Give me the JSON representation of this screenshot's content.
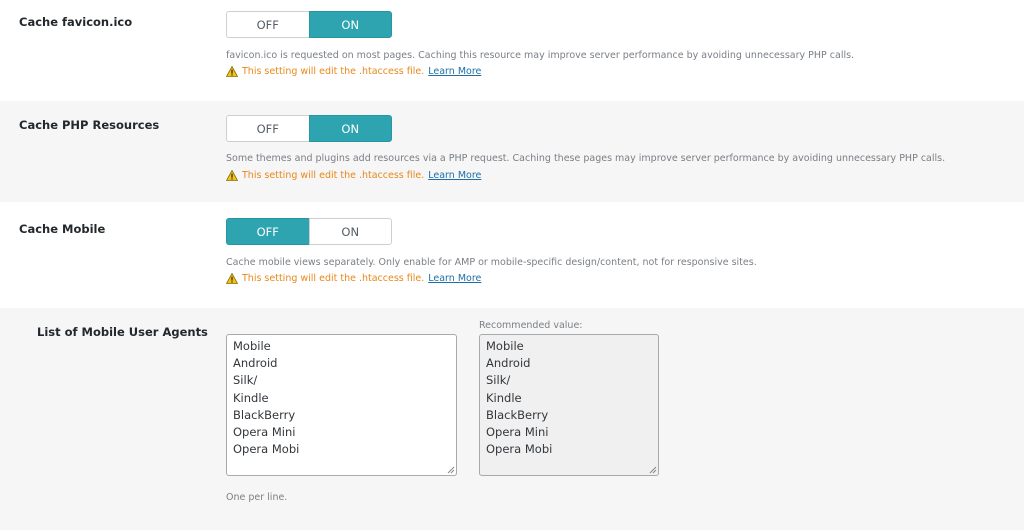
{
  "settings": [
    {
      "label": "Cache favicon.ico",
      "off_label": "OFF",
      "on_label": "ON",
      "state": "on",
      "description": "favicon.ico is requested on most pages. Caching this resource may improve server performance by avoiding unnecessary PHP calls.",
      "warning": "This setting will edit the .htaccess file.",
      "learn_more": "Learn More"
    },
    {
      "label": "Cache PHP Resources",
      "off_label": "OFF",
      "on_label": "ON",
      "state": "on",
      "description": "Some themes and plugins add resources via a PHP request. Caching these pages may improve server performance by avoiding unnecessary PHP calls.",
      "warning": "This setting will edit the .htaccess file.",
      "learn_more": "Learn More"
    },
    {
      "label": "Cache Mobile",
      "off_label": "OFF",
      "on_label": "ON",
      "state": "off",
      "description": "Cache mobile views separately. Only enable for AMP or mobile-specific design/content, not for responsive sites.",
      "warning": "This setting will edit the .htaccess file.",
      "learn_more": "Learn More"
    }
  ],
  "mobile_agents": {
    "label": "List of Mobile User Agents",
    "value": "Mobile\nAndroid\nSilk/\nKindle\nBlackBerry\nOpera Mini\nOpera Mobi",
    "recommended_label": "Recommended value:",
    "recommended_value": "Mobile\nAndroid\nSilk/\nKindle\nBlackBerry\nOpera Mini\nOpera Mobi",
    "hint": "One per line."
  },
  "colors": {
    "accent": "#2fa4b1",
    "warning": "#e9881a",
    "link": "#1e6fa8",
    "alt_row_bg": "#f6f6f6"
  }
}
